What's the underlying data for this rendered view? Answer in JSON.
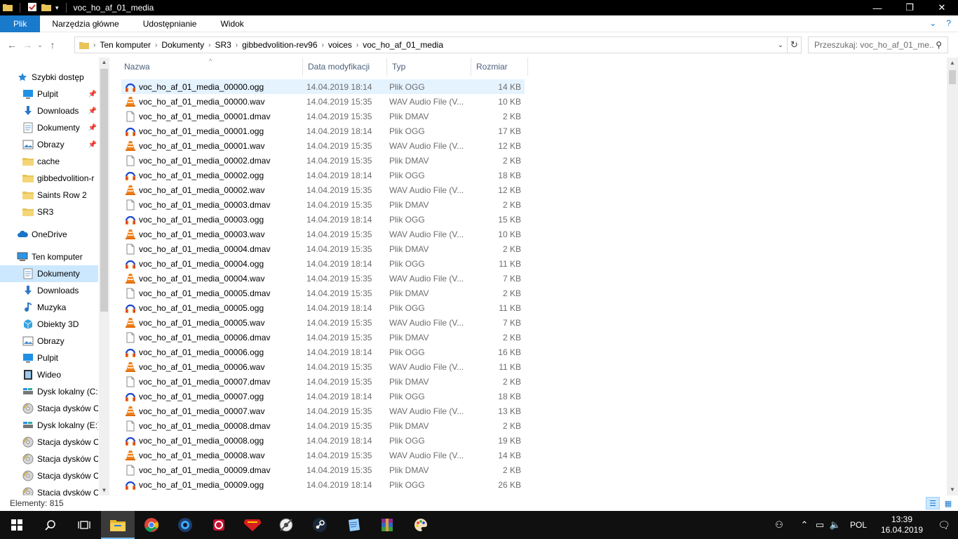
{
  "window": {
    "title": "voc_ho_af_01_media",
    "minimize_icon": "minimize-icon",
    "maximize_icon": "maximize-icon",
    "close_icon": "close-icon"
  },
  "ribbon": {
    "tabs": [
      {
        "label": "Plik"
      },
      {
        "label": "Narzędzia główne"
      },
      {
        "label": "Udostępnianie"
      },
      {
        "label": "Widok"
      }
    ],
    "accent": "#1979ca"
  },
  "address": {
    "crumbs": [
      "Ten komputer",
      "Dokumenty",
      "SR3",
      "gibbedvolition-rev96",
      "voices",
      "voc_ho_af_01_media"
    ]
  },
  "search": {
    "placeholder": "Przeszukaj: voc_ho_af_01_me..."
  },
  "nav": {
    "items": [
      {
        "label": "Szybki dostęp",
        "icon": "star-icon",
        "level": 0,
        "pinned": false,
        "selected": false
      },
      {
        "label": "Pulpit",
        "icon": "desktop-icon",
        "level": 1,
        "pinned": true,
        "selected": false
      },
      {
        "label": "Downloads",
        "icon": "download-icon",
        "level": 1,
        "pinned": true,
        "selected": false
      },
      {
        "label": "Dokumenty",
        "icon": "documents-icon",
        "level": 1,
        "pinned": true,
        "selected": false
      },
      {
        "label": "Obrazy",
        "icon": "pictures-icon",
        "level": 1,
        "pinned": true,
        "selected": false
      },
      {
        "label": "cache",
        "icon": "folder-icon",
        "level": 1,
        "pinned": false,
        "selected": false
      },
      {
        "label": "gibbedvolition-r",
        "icon": "folder-icon",
        "level": 1,
        "pinned": false,
        "selected": false
      },
      {
        "label": "Saints Row 2",
        "icon": "folder-icon",
        "level": 1,
        "pinned": false,
        "selected": false
      },
      {
        "label": "SR3",
        "icon": "folder-icon",
        "level": 1,
        "pinned": false,
        "selected": false
      },
      {
        "label": "OneDrive",
        "icon": "onedrive-icon",
        "level": 0,
        "pinned": false,
        "selected": false,
        "gap": true
      },
      {
        "label": "Ten komputer",
        "icon": "computer-icon",
        "level": 0,
        "pinned": false,
        "selected": false,
        "gap": true
      },
      {
        "label": "Dokumenty",
        "icon": "documents-icon",
        "level": 1,
        "pinned": false,
        "selected": true
      },
      {
        "label": "Downloads",
        "icon": "download-icon",
        "level": 1,
        "pinned": false,
        "selected": false
      },
      {
        "label": "Muzyka",
        "icon": "music-icon",
        "level": 1,
        "pinned": false,
        "selected": false
      },
      {
        "label": "Obiekty 3D",
        "icon": "3d-objects-icon",
        "level": 1,
        "pinned": false,
        "selected": false
      },
      {
        "label": "Obrazy",
        "icon": "pictures-icon",
        "level": 1,
        "pinned": false,
        "selected": false
      },
      {
        "label": "Pulpit",
        "icon": "desktop-icon",
        "level": 1,
        "pinned": false,
        "selected": false
      },
      {
        "label": "Wideo",
        "icon": "video-icon",
        "level": 1,
        "pinned": false,
        "selected": false
      },
      {
        "label": "Dysk lokalny (C:)",
        "icon": "drive-icon",
        "level": 1,
        "pinned": false,
        "selected": false
      },
      {
        "label": "Stacja dysków C",
        "icon": "disc-drive-icon",
        "level": 1,
        "pinned": false,
        "selected": false
      },
      {
        "label": "Dysk lokalny (E:)",
        "icon": "drive-icon",
        "level": 1,
        "pinned": false,
        "selected": false
      },
      {
        "label": "Stacja dysków C",
        "icon": "disc-drive-icon",
        "level": 1,
        "pinned": false,
        "selected": false
      },
      {
        "label": "Stacja dysków C",
        "icon": "disc-drive-icon",
        "level": 1,
        "pinned": false,
        "selected": false
      },
      {
        "label": "Stacja dysków C",
        "icon": "disc-drive-icon",
        "level": 1,
        "pinned": false,
        "selected": false
      },
      {
        "label": "Stacja dysków C",
        "icon": "disc-drive-icon",
        "level": 1,
        "pinned": false,
        "selected": false
      }
    ]
  },
  "columns": {
    "name": "Nazwa",
    "date": "Data modyfikacji",
    "type": "Typ",
    "size": "Rozmiar"
  },
  "files": [
    {
      "name": "voc_ho_af_01_media_00000.ogg",
      "date": "14.04.2019 18:14",
      "type": "Plik OGG",
      "size": "14 KB",
      "icon": "ogg-file-icon",
      "selected": true
    },
    {
      "name": "voc_ho_af_01_media_00000.wav",
      "date": "14.04.2019 15:35",
      "type": "WAV Audio File (V...",
      "size": "10 KB",
      "icon": "vlc-file-icon"
    },
    {
      "name": "voc_ho_af_01_media_00001.dmav",
      "date": "14.04.2019 15:35",
      "type": "Plik DMAV",
      "size": "2 KB",
      "icon": "blank-file-icon"
    },
    {
      "name": "voc_ho_af_01_media_00001.ogg",
      "date": "14.04.2019 18:14",
      "type": "Plik OGG",
      "size": "17 KB",
      "icon": "ogg-file-icon"
    },
    {
      "name": "voc_ho_af_01_media_00001.wav",
      "date": "14.04.2019 15:35",
      "type": "WAV Audio File (V...",
      "size": "12 KB",
      "icon": "vlc-file-icon"
    },
    {
      "name": "voc_ho_af_01_media_00002.dmav",
      "date": "14.04.2019 15:35",
      "type": "Plik DMAV",
      "size": "2 KB",
      "icon": "blank-file-icon"
    },
    {
      "name": "voc_ho_af_01_media_00002.ogg",
      "date": "14.04.2019 18:14",
      "type": "Plik OGG",
      "size": "18 KB",
      "icon": "ogg-file-icon"
    },
    {
      "name": "voc_ho_af_01_media_00002.wav",
      "date": "14.04.2019 15:35",
      "type": "WAV Audio File (V...",
      "size": "12 KB",
      "icon": "vlc-file-icon"
    },
    {
      "name": "voc_ho_af_01_media_00003.dmav",
      "date": "14.04.2019 15:35",
      "type": "Plik DMAV",
      "size": "2 KB",
      "icon": "blank-file-icon"
    },
    {
      "name": "voc_ho_af_01_media_00003.ogg",
      "date": "14.04.2019 18:14",
      "type": "Plik OGG",
      "size": "15 KB",
      "icon": "ogg-file-icon"
    },
    {
      "name": "voc_ho_af_01_media_00003.wav",
      "date": "14.04.2019 15:35",
      "type": "WAV Audio File (V...",
      "size": "10 KB",
      "icon": "vlc-file-icon"
    },
    {
      "name": "voc_ho_af_01_media_00004.dmav",
      "date": "14.04.2019 15:35",
      "type": "Plik DMAV",
      "size": "2 KB",
      "icon": "blank-file-icon"
    },
    {
      "name": "voc_ho_af_01_media_00004.ogg",
      "date": "14.04.2019 18:14",
      "type": "Plik OGG",
      "size": "11 KB",
      "icon": "ogg-file-icon"
    },
    {
      "name": "voc_ho_af_01_media_00004.wav",
      "date": "14.04.2019 15:35",
      "type": "WAV Audio File (V...",
      "size": "7 KB",
      "icon": "vlc-file-icon"
    },
    {
      "name": "voc_ho_af_01_media_00005.dmav",
      "date": "14.04.2019 15:35",
      "type": "Plik DMAV",
      "size": "2 KB",
      "icon": "blank-file-icon"
    },
    {
      "name": "voc_ho_af_01_media_00005.ogg",
      "date": "14.04.2019 18:14",
      "type": "Plik OGG",
      "size": "11 KB",
      "icon": "ogg-file-icon"
    },
    {
      "name": "voc_ho_af_01_media_00005.wav",
      "date": "14.04.2019 15:35",
      "type": "WAV Audio File (V...",
      "size": "7 KB",
      "icon": "vlc-file-icon"
    },
    {
      "name": "voc_ho_af_01_media_00006.dmav",
      "date": "14.04.2019 15:35",
      "type": "Plik DMAV",
      "size": "2 KB",
      "icon": "blank-file-icon"
    },
    {
      "name": "voc_ho_af_01_media_00006.ogg",
      "date": "14.04.2019 18:14",
      "type": "Plik OGG",
      "size": "16 KB",
      "icon": "ogg-file-icon"
    },
    {
      "name": "voc_ho_af_01_media_00006.wav",
      "date": "14.04.2019 15:35",
      "type": "WAV Audio File (V...",
      "size": "11 KB",
      "icon": "vlc-file-icon"
    },
    {
      "name": "voc_ho_af_01_media_00007.dmav",
      "date": "14.04.2019 15:35",
      "type": "Plik DMAV",
      "size": "2 KB",
      "icon": "blank-file-icon"
    },
    {
      "name": "voc_ho_af_01_media_00007.ogg",
      "date": "14.04.2019 18:14",
      "type": "Plik OGG",
      "size": "18 KB",
      "icon": "ogg-file-icon"
    },
    {
      "name": "voc_ho_af_01_media_00007.wav",
      "date": "14.04.2019 15:35",
      "type": "WAV Audio File (V...",
      "size": "13 KB",
      "icon": "vlc-file-icon"
    },
    {
      "name": "voc_ho_af_01_media_00008.dmav",
      "date": "14.04.2019 15:35",
      "type": "Plik DMAV",
      "size": "2 KB",
      "icon": "blank-file-icon"
    },
    {
      "name": "voc_ho_af_01_media_00008.ogg",
      "date": "14.04.2019 18:14",
      "type": "Plik OGG",
      "size": "19 KB",
      "icon": "ogg-file-icon"
    },
    {
      "name": "voc_ho_af_01_media_00008.wav",
      "date": "14.04.2019 15:35",
      "type": "WAV Audio File (V...",
      "size": "14 KB",
      "icon": "vlc-file-icon"
    },
    {
      "name": "voc_ho_af_01_media_00009.dmav",
      "date": "14.04.2019 15:35",
      "type": "Plik DMAV",
      "size": "2 KB",
      "icon": "blank-file-icon"
    },
    {
      "name": "voc_ho_af_01_media_00009.ogg",
      "date": "14.04.2019 18:14",
      "type": "Plik OGG",
      "size": "26 KB",
      "icon": "ogg-file-icon"
    }
  ],
  "status": {
    "count_text": "Elementy: 815"
  },
  "taskbar": {
    "apps": [
      {
        "icon": "windows-start-icon"
      },
      {
        "icon": "search-icon"
      },
      {
        "icon": "task-view-icon"
      },
      {
        "icon": "file-explorer-icon",
        "active": true
      },
      {
        "icon": "chrome-icon"
      },
      {
        "icon": "app-eye-icon"
      },
      {
        "icon": "media-app-icon"
      },
      {
        "icon": "superman-app-icon"
      },
      {
        "icon": "disc-app-icon"
      },
      {
        "icon": "steam-icon"
      },
      {
        "icon": "notepad-app-icon"
      },
      {
        "icon": "winrar-icon"
      },
      {
        "icon": "paint-icon"
      }
    ],
    "language": "POL",
    "time": "13:39",
    "date": "16.04.2019"
  }
}
